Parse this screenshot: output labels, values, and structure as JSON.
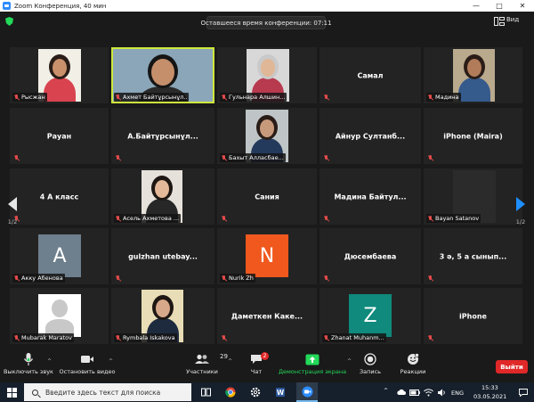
{
  "window": {
    "title": "Zoom Конференция, 40 мин"
  },
  "header": {
    "time_left": "Оставшееся время конференции: 07:11",
    "view_label": "Вид"
  },
  "tiles": [
    {
      "name": "Рысжан",
      "muted": true
    },
    {
      "name": "Ахмет Байтұрсынұл...",
      "muted": true,
      "active": true
    },
    {
      "name": "Гульнара Алшин...",
      "muted": true
    },
    {
      "name": "Самал",
      "muted": true
    },
    {
      "name": "Мадина",
      "muted": true
    },
    {
      "name": "Рауан",
      "muted": true
    },
    {
      "name": "А.Байтұрсынұл...",
      "muted": true
    },
    {
      "name": "Бахыт Алласбае...",
      "muted": true
    },
    {
      "name": "Айнур Султанб...",
      "muted": true
    },
    {
      "name": "iPhone (Maira)",
      "muted": true
    },
    {
      "name": "4 А класс",
      "muted": true
    },
    {
      "name": "Асель Ахметова ...",
      "muted": true
    },
    {
      "name": "Сания",
      "muted": true
    },
    {
      "name": "Мадина Байтул...",
      "muted": true
    },
    {
      "name": "Bayan Satanov",
      "muted": true
    },
    {
      "name": "Акку Абенова",
      "muted": true,
      "avatar_letter": "A",
      "avatar_color": "#6e7f8d"
    },
    {
      "name": "gulzhan utebay...",
      "muted": true
    },
    {
      "name": "Nurik Zh",
      "muted": true,
      "avatar_letter": "N",
      "avatar_color": "#f0581e"
    },
    {
      "name": "Дюсембаева",
      "muted": true
    },
    {
      "name": "3 ә, 5 а сынып...",
      "muted": true
    },
    {
      "name": "Mubarak Maratov",
      "muted": true
    },
    {
      "name": "Rymbala Iskakova",
      "muted": true
    },
    {
      "name": "Даметкен Каке...",
      "muted": true
    },
    {
      "name": "Zhanat Muhanm...",
      "muted": true,
      "avatar_letter": "Z",
      "avatar_color": "#0f8a7c"
    },
    {
      "name": "iPhone",
      "muted": true
    }
  ],
  "pagination": {
    "left_page": "1/2",
    "right_page": "1/2"
  },
  "toolbar": {
    "mute_label": "Выключить звук",
    "video_label": "Остановить видео",
    "participants_label": "Участники",
    "participants_count": "29",
    "chat_label": "Чат",
    "chat_badge": "2",
    "share_label": "Демонстрация экрана",
    "record_label": "Запись",
    "reactions_label": "Реакции",
    "leave_label": "Выйти"
  },
  "taskbar": {
    "search_placeholder": "Введите здесь текст для поиска",
    "lang": "ENG",
    "time": "15:33",
    "date": "03.05.2021"
  },
  "colors": {
    "active_speaker": "#cfe83a",
    "share_green": "#23d959",
    "leave_red": "#e02828",
    "muted_red": "#e24a4a"
  }
}
